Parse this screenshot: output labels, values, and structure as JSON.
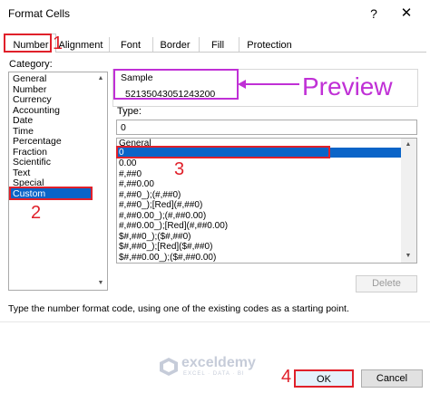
{
  "window": {
    "title": "Format Cells",
    "help_glyph": "?",
    "close_glyph": "✕"
  },
  "tabs": [
    {
      "label": "Number",
      "active": true
    },
    {
      "label": "Alignment"
    },
    {
      "label": "Font"
    },
    {
      "label": "Border"
    },
    {
      "label": "Fill"
    },
    {
      "label": "Protection"
    }
  ],
  "category": {
    "label": "Category:",
    "items": [
      "General",
      "Number",
      "Currency",
      "Accounting",
      "Date",
      "Time",
      "Percentage",
      "Fraction",
      "Scientific",
      "Text",
      "Special",
      "Custom"
    ],
    "selected": "Custom"
  },
  "sample": {
    "label": "Sample",
    "value": "52135043051243200"
  },
  "type": {
    "label": "Type:",
    "value": "0"
  },
  "formats": {
    "items": [
      "General",
      "0",
      "0.00",
      "#,##0",
      "#,##0.00",
      "#,##0_);(#,##0)",
      "#,##0_);[Red](#,##0)",
      "#,##0.00_);(#,##0.00)",
      "#,##0.00_);[Red](#,##0.00)",
      "$#,##0_);($#,##0)",
      "$#,##0_);[Red]($#,##0)",
      "$#,##0.00_);($#,##0.00)"
    ],
    "selected": "0"
  },
  "buttons": {
    "delete": "Delete",
    "ok": "OK",
    "cancel": "Cancel"
  },
  "hint_text": "Type the number format code, using one of the existing codes as a starting point.",
  "annotations": {
    "preview": "Preview",
    "step1": "1",
    "step2": "2",
    "step3": "3",
    "step4": "4",
    "highlight_color": "#e0202a",
    "preview_color": "#c030d6"
  },
  "watermark": {
    "name": "exceldemy",
    "tagline": "EXCEL · DATA · BI"
  }
}
